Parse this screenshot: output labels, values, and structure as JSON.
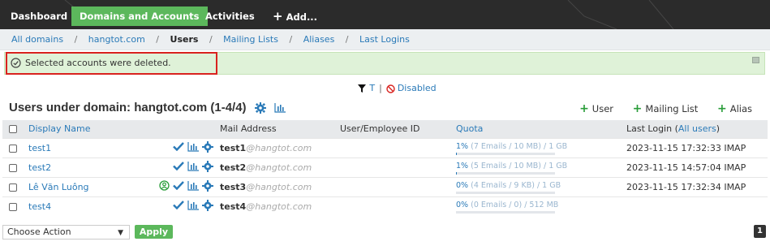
{
  "nav": {
    "tabs": [
      {
        "label": "Dashboard"
      },
      {
        "label": "Domains and Accounts"
      },
      {
        "label": "Activities"
      },
      {
        "label": "Add..."
      }
    ]
  },
  "breadcrumb": {
    "all_domains": "All domains",
    "domain": "hangtot.com",
    "users": "Users",
    "mailing_lists": "Mailing Lists",
    "aliases": "Aliases",
    "last_logins": "Last Logins",
    "separator": "/"
  },
  "alert": {
    "message": "Selected accounts were deleted."
  },
  "filter": {
    "t_label": "T",
    "separator": "|",
    "disabled_label": "Disabled"
  },
  "heading": {
    "title": "Users under domain: hangtot.com (1-4/4)"
  },
  "actions": {
    "add_user": "User",
    "add_mailing_list": "Mailing List",
    "add_alias": "Alias"
  },
  "table": {
    "headers": {
      "display_name": "Display Name",
      "mail_address": "Mail Address",
      "user_id": "User/Employee ID",
      "quota": "Quota",
      "last_login": "Last Login (",
      "all_users": "All users",
      "last_login_close": ")"
    },
    "rows": [
      {
        "name": "test1",
        "mail_local": "test1",
        "mail_domain": "@hangtot.com",
        "uid": "",
        "quota_pct": "1%",
        "quota_detail": "(7 Emails / 10 MB) / 1 GB",
        "quota_fraction": 0.01,
        "last_login": "2023-11-15 17:32:33 IMAP",
        "has_badge": false
      },
      {
        "name": "test2",
        "mail_local": "test2",
        "mail_domain": "@hangtot.com",
        "uid": "",
        "quota_pct": "1%",
        "quota_detail": "(5 Emails / 10 MB) / 1 GB",
        "quota_fraction": 0.01,
        "last_login": "2023-11-15 14:57:04 IMAP",
        "has_badge": false
      },
      {
        "name": "Lê Văn Luông",
        "mail_local": "test3",
        "mail_domain": "@hangtot.com",
        "uid": "",
        "quota_pct": "0%",
        "quota_detail": "(4 Emails / 9 KB) / 1 GB",
        "quota_fraction": 0.0,
        "last_login": "2023-11-15 17:32:34 IMAP",
        "has_badge": true
      },
      {
        "name": "test4",
        "mail_local": "test4",
        "mail_domain": "@hangtot.com",
        "uid": "",
        "quota_pct": "0%",
        "quota_detail": "(0 Emails / 0) / 512 MB",
        "quota_fraction": 0.0,
        "last_login": "",
        "has_badge": false
      }
    ]
  },
  "bottom": {
    "select_value": "Choose Action",
    "apply_label": "Apply",
    "page_number": "1"
  },
  "colors": {
    "accent_green": "#5cb85c",
    "link_blue": "#2a7ab8",
    "alert_bg": "#dff2d8",
    "highlight_red": "#d9231f",
    "disabled_red": "#d9231f"
  }
}
